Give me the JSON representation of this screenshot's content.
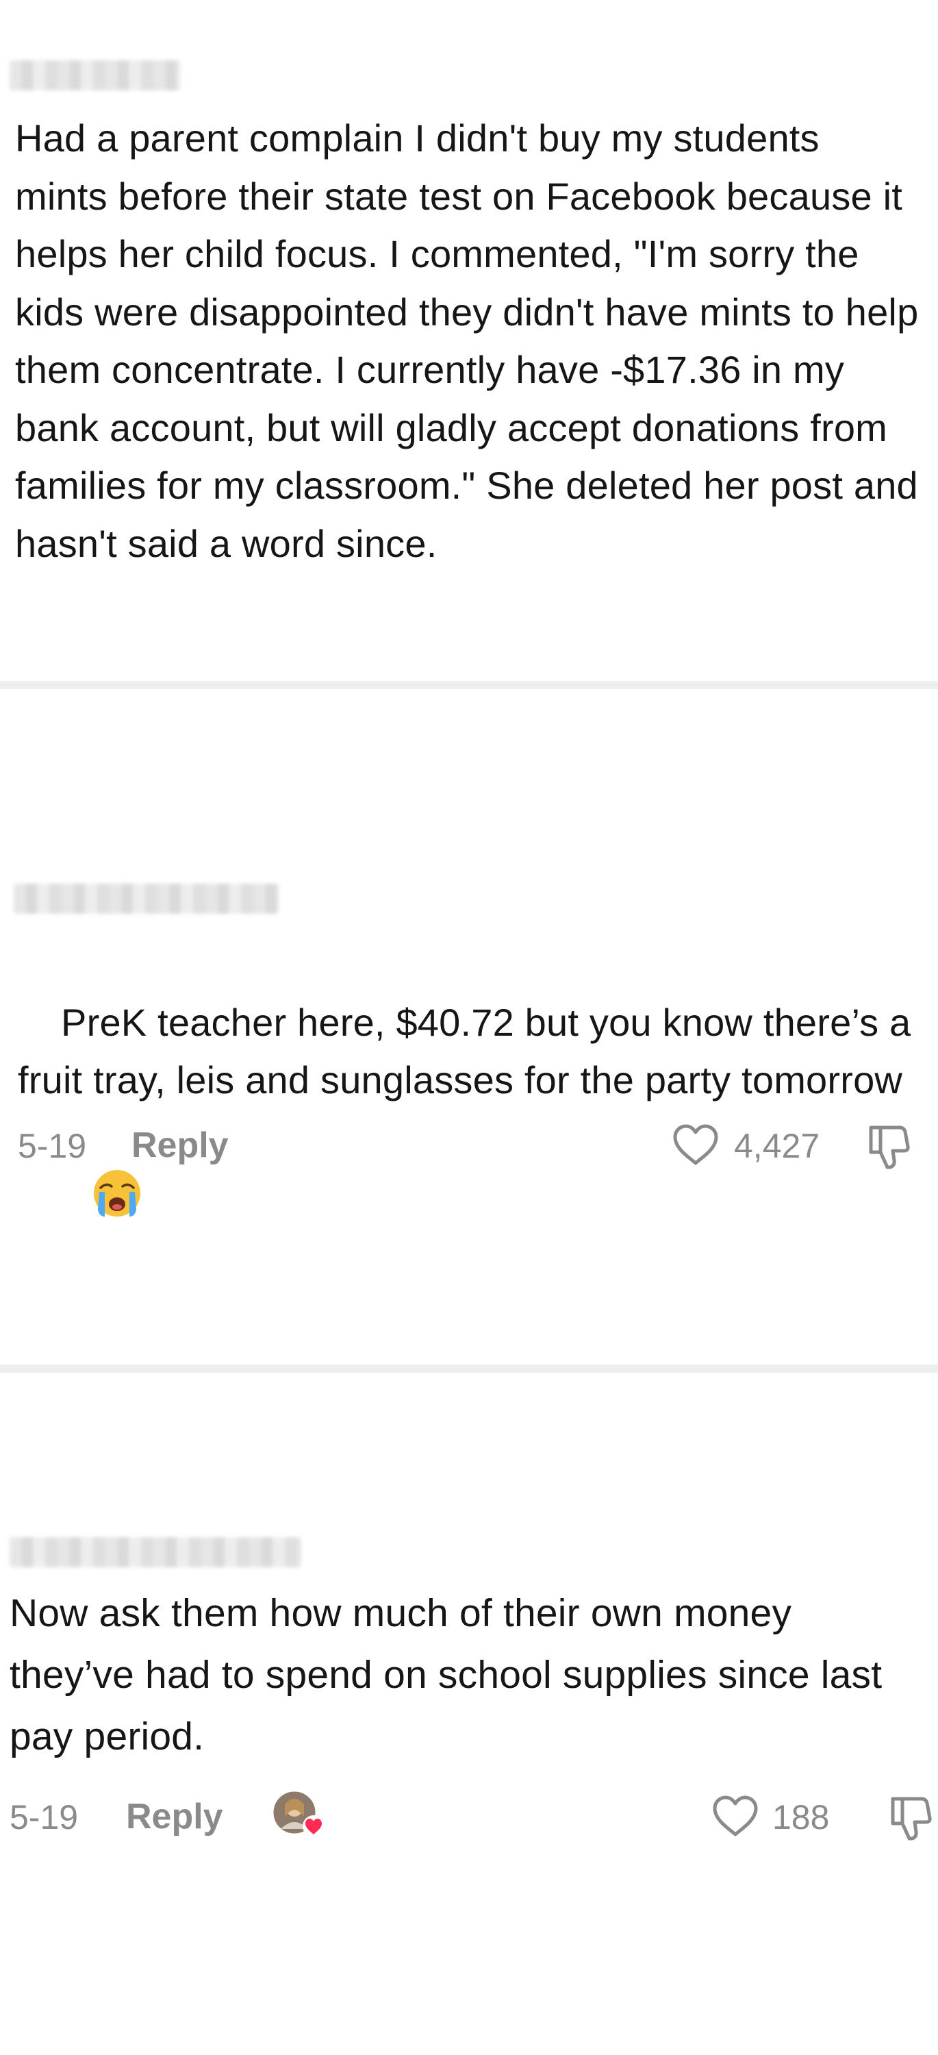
{
  "comments": [
    {
      "text": "Had a parent complain I didn't buy my students mints before their state test on Facebook because it helps her child focus. I commented, \"I'm sorry the kids were disappointed they didn't have mints to help them concentrate. I currently have -$17.36 in my bank account, but will gladly accept donations from families for my classroom.\" She deleted her post and hasn't said a word since."
    },
    {
      "text": "PreK teacher here, $40.72 but you know there’s a fruit tray, leis and sunglasses for the party tomorrow",
      "emoji": "😭",
      "date": "5-19",
      "reply_label": "Reply",
      "likes": "4,427"
    },
    {
      "text": "Now ask them how much of their own money they’ve had to spend on school supplies since last pay period.",
      "date": "5-19",
      "reply_label": "Reply",
      "likes": "188",
      "creator_liked": true
    }
  ],
  "icons": {
    "like": "heart-outline-icon",
    "dislike": "thumbs-down-icon",
    "creator_heart": "creator-heart-icon"
  },
  "colors": {
    "divider": "#eeeeee",
    "meta_gray": "#8a8a8a",
    "creator_heart": "#fe2c55"
  }
}
